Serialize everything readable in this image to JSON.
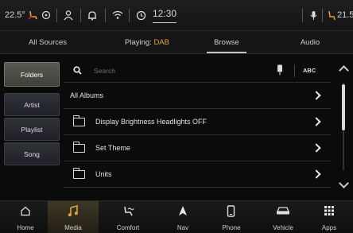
{
  "status": {
    "temp_left": "22.5°",
    "time": "12:30",
    "temp_right": "21.5°"
  },
  "tabs": [
    {
      "label": "All Sources"
    },
    {
      "label_prefix": "Playing: ",
      "label_value": "DAB"
    },
    {
      "label": "Browse"
    },
    {
      "label": "Audio"
    }
  ],
  "side_filters": [
    {
      "label": "Folders",
      "active": true
    },
    {
      "label": "Artist"
    },
    {
      "label": "Playlist"
    },
    {
      "label": "Song"
    }
  ],
  "search": {
    "placeholder": "Search",
    "abc_label": "ABC"
  },
  "list": [
    {
      "label": "All Albums",
      "folder": false
    },
    {
      "label": "Display Brightness Headlights OFF",
      "folder": true
    },
    {
      "label": "Set Theme",
      "folder": true
    },
    {
      "label": "Units",
      "folder": true
    }
  ],
  "bottom_nav": [
    {
      "label": "Home",
      "icon": "home-icon"
    },
    {
      "label": "Media",
      "icon": "music-note-icon",
      "active": true
    },
    {
      "label": "Comfort",
      "icon": "seat-icon"
    },
    {
      "label": "Nav",
      "icon": "navigation-arrow-icon"
    },
    {
      "label": "Phone",
      "icon": "phone-icon"
    },
    {
      "label": "Vehicle",
      "icon": "car-icon"
    },
    {
      "label": "Apps",
      "icon": "apps-grid-icon"
    }
  ],
  "colors": {
    "accent": "#e0a43a"
  }
}
